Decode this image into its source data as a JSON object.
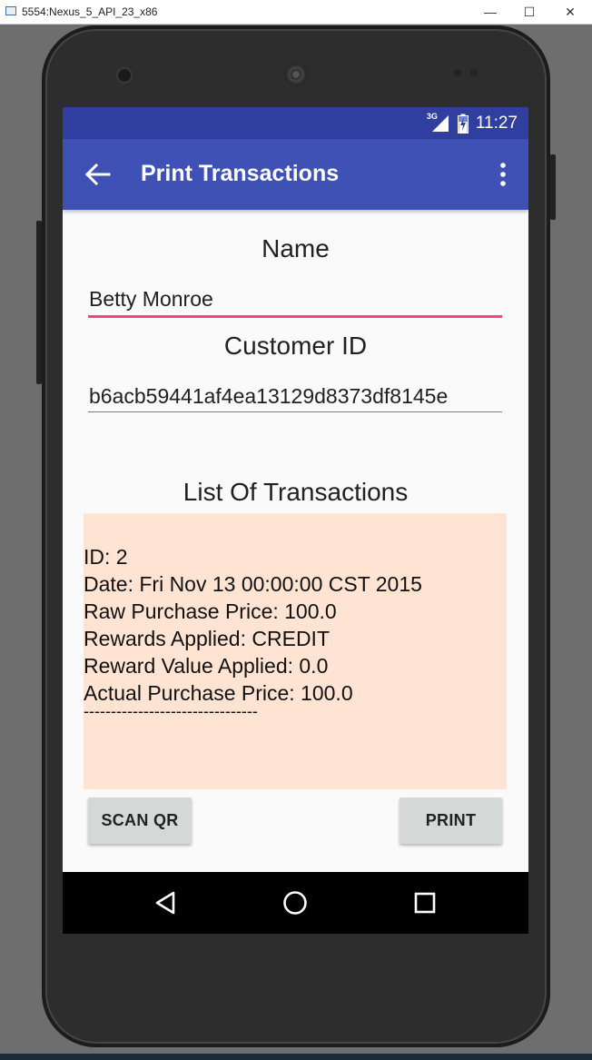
{
  "window": {
    "title": "5554:Nexus_5_API_23_x86",
    "controls": {
      "minimize": "—",
      "maximize": "☐",
      "close": "✕"
    }
  },
  "statusbar": {
    "network": "3G",
    "time": "11:27"
  },
  "appbar": {
    "title": "Print Transactions",
    "icons": {
      "back": "arrow-back-icon",
      "overflow": "more-vert-icon"
    }
  },
  "form": {
    "name_label": "Name",
    "name_value": "Betty Monroe",
    "customer_id_label": "Customer ID",
    "customer_id_value": "b6acb59441af4ea13129d8373df8145e"
  },
  "transactions": {
    "heading": "List Of Transactions",
    "lines": [
      "ID: 2",
      "Date: Fri Nov 13 00:00:00 CST 2015",
      "Raw Purchase Price: 100.0",
      "Rewards Applied: CREDIT",
      "Reward Value Applied: 0.0",
      "Actual Purchase Price: 100.0",
      "--------------------------------"
    ]
  },
  "buttons": {
    "scan_qr": "SCAN QR",
    "print": "PRINT"
  },
  "navbar": {
    "icons": [
      "back-triangle-icon",
      "home-circle-icon",
      "recents-square-icon"
    ]
  },
  "colors": {
    "primary": "#3f51b5",
    "primary_dark": "#303f9f",
    "accent": "#ff4081",
    "list_background": "#ffe4d3",
    "button": "#d6d7d7"
  }
}
